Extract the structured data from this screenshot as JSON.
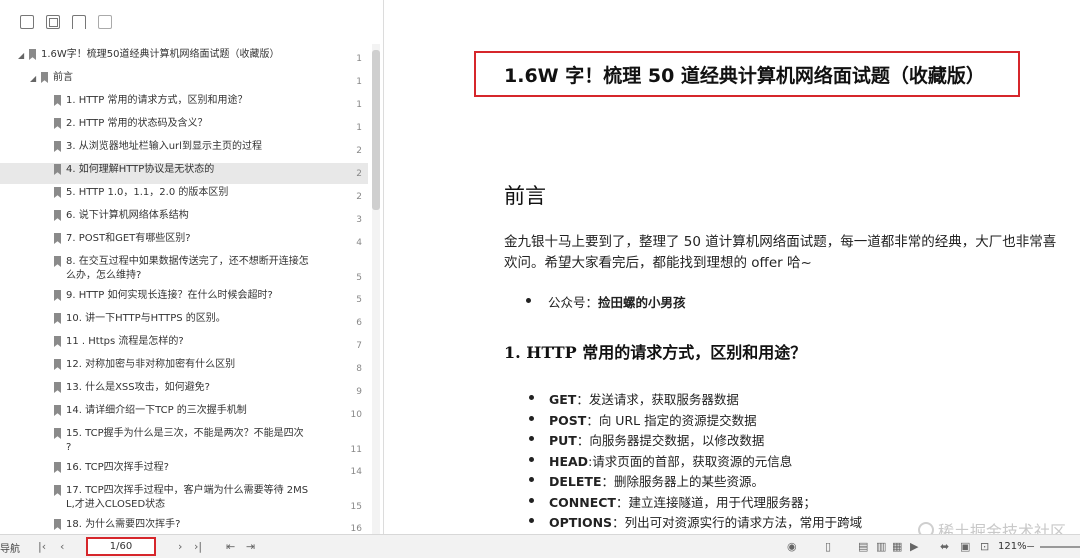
{
  "toc": {
    "items": [
      {
        "level": 0,
        "arrow": true,
        "text": "1.6W字！梳理50道经典计算机网络面试题（收藏版）",
        "page": "1"
      },
      {
        "level": 1,
        "arrow": true,
        "text": "前言",
        "page": "1"
      },
      {
        "level": 2,
        "text": "1. HTTP 常用的请求方式，区别和用途？",
        "page": "1"
      },
      {
        "level": 2,
        "text": "2. HTTP 常用的状态码及含义？",
        "page": "1"
      },
      {
        "level": 2,
        "text": "3. 从浏览器地址栏输入url到显示主页的过程",
        "page": "2"
      },
      {
        "level": 2,
        "text": "4. 如何理解HTTP协议是无状态的",
        "page": "2",
        "selected": true
      },
      {
        "level": 2,
        "text": "5. HTTP 1.0，1.1，2.0 的版本区别",
        "page": "2"
      },
      {
        "level": 2,
        "text": "6. 说下计算机网络体系结构",
        "page": "3"
      },
      {
        "level": 2,
        "text": "7. POST和GET有哪些区别?",
        "page": "4"
      },
      {
        "level": 2,
        "text": "8. 在交互过程中如果数据传送完了，还不想断开连接怎",
        "text2": "么办，怎么维持?",
        "page": "5"
      },
      {
        "level": 2,
        "text": "9. HTTP 如何实现长连接？在什么时候会超时?",
        "page": "5"
      },
      {
        "level": 2,
        "text": "10. 讲一下HTTP与HTTPS 的区别。",
        "page": "6"
      },
      {
        "level": 2,
        "text": "11 . Https 流程是怎样的?",
        "page": "7"
      },
      {
        "level": 2,
        "text": "12. 对称加密与非对称加密有什么区别",
        "page": "8"
      },
      {
        "level": 2,
        "text": "13. 什么是XSS攻击，如何避免?",
        "page": "9"
      },
      {
        "level": 2,
        "text": "14. 请详细介绍一下TCP 的三次握手机制",
        "page": "10"
      },
      {
        "level": 2,
        "text": "15. TCP握手为什么是三次，不能是两次？不能是四次",
        "text2": "?",
        "page": "11"
      },
      {
        "level": 2,
        "text": "16. TCP四次挥手过程?",
        "page": "14"
      },
      {
        "level": 2,
        "text": "17. TCP四次挥手过程中，客户端为什么需要等待 2MS",
        "text2": "L,才进入CLOSED状态",
        "page": "15"
      },
      {
        "level": 2,
        "text": "18. 为什么需要四次挥手?",
        "page": "16"
      }
    ]
  },
  "document": {
    "title": "1.6W 字！梳理 50 道经典计算机网络面试题（收藏版）",
    "preface_heading": "前言",
    "preface_para": "金九银十马上要到了，整理了 50 道计算机网络面试题，每一道都非常的经典，大厂也非常喜欢问。希望大家看完后，都能找到理想的 offer 哈~",
    "account_label": "公众号：",
    "account_name": "捡田螺的小男孩",
    "section1_heading": "1.  HTTP  常用的请求方式，区别和用途？",
    "methods": [
      {
        "name": "GET",
        "desc": "：发送请求，获取服务器数据"
      },
      {
        "name": "POST",
        "desc": "：向 URL 指定的资源提交数据"
      },
      {
        "name": "PUT",
        "desc": "：向服务器提交数据，以修改数据"
      },
      {
        "name": "HEAD",
        "desc": ":请求页面的首部，获取资源的元信息"
      },
      {
        "name": "DELETE",
        "desc": "：删除服务器上的某些资源。"
      },
      {
        "name": "CONNECT",
        "desc": "：建立连接隧道，用于代理服务器；"
      },
      {
        "name": "OPTIONS",
        "desc": "：列出可对资源实行的请求方法，常用于跨域"
      }
    ]
  },
  "watermark": "稀土掘金技术社区",
  "statusbar": {
    "nav_label": "导航",
    "page_indicator": "1/60",
    "zoom": "121%"
  },
  "colors": {
    "highlight_red": "#d6262b",
    "selected_row": "#e8e8e8"
  }
}
